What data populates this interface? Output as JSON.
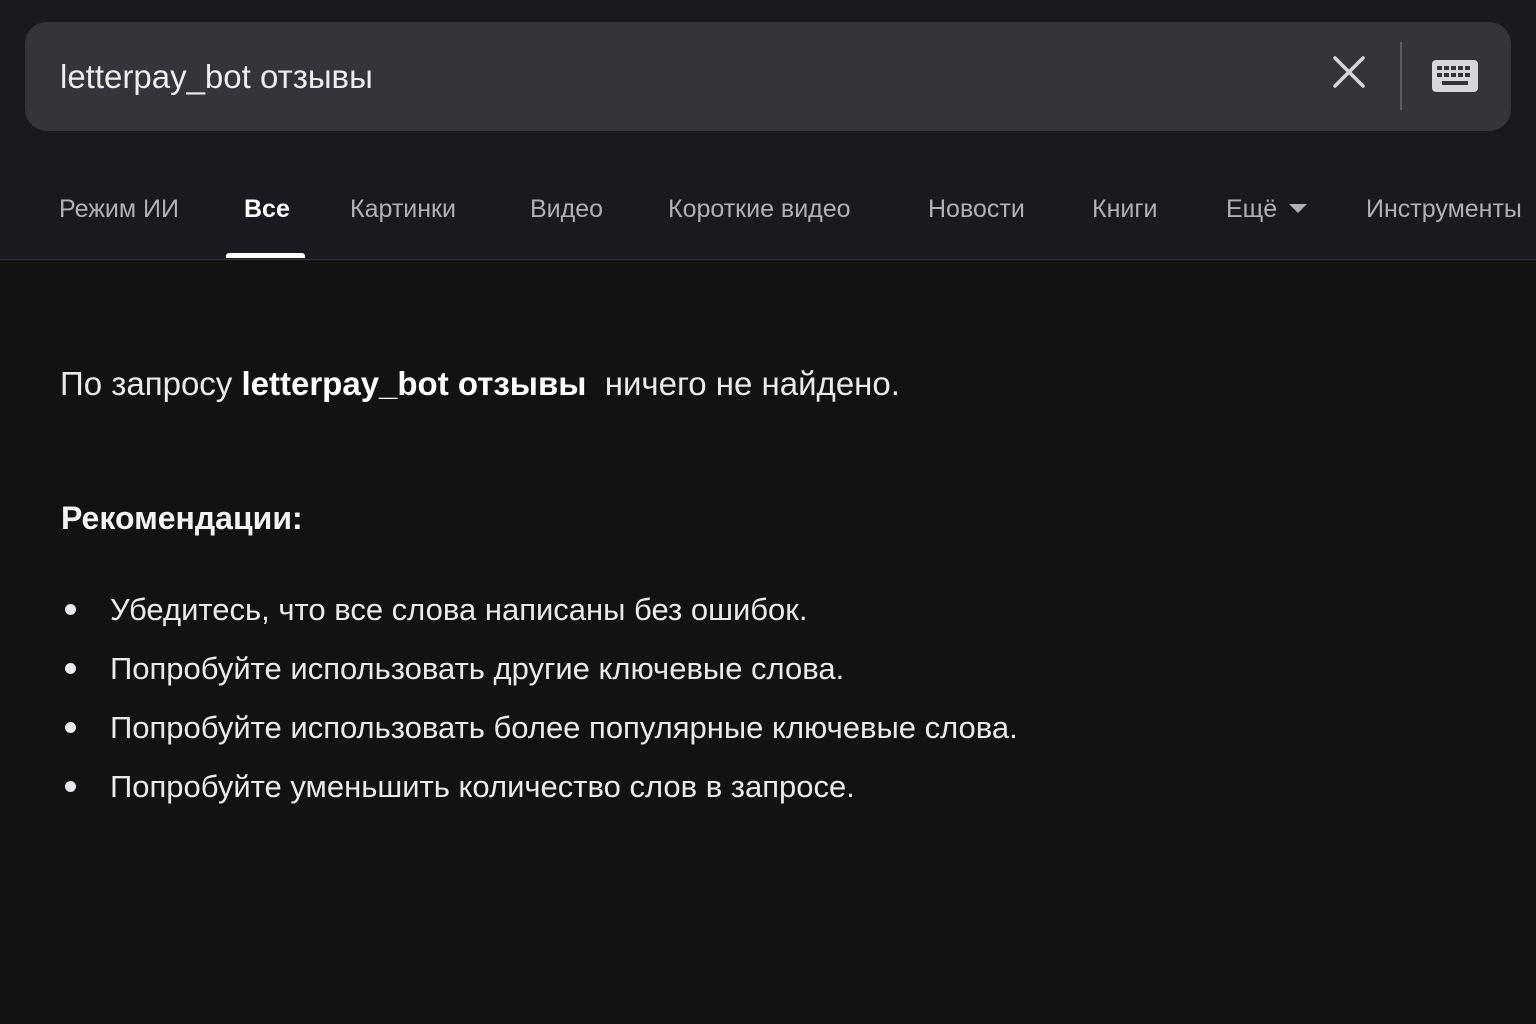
{
  "search": {
    "query": "letterpay_bot отзывы"
  },
  "tabs": [
    {
      "label": "Режим ИИ",
      "active": false
    },
    {
      "label": "Все",
      "active": true
    },
    {
      "label": "Картинки",
      "active": false
    },
    {
      "label": "Видео",
      "active": false
    },
    {
      "label": "Короткие видео",
      "active": false
    },
    {
      "label": "Новости",
      "active": false
    },
    {
      "label": "Книги",
      "active": false
    },
    {
      "label": "Ещё",
      "active": false
    },
    {
      "label": "Инструменты",
      "active": false
    }
  ],
  "noresult": {
    "prefix": "По запросу",
    "query": "letterpay_bot отзывы",
    "suffix": "ничего не найдено."
  },
  "recommendations": {
    "title": "Рекомендации:",
    "items": [
      "Убедитесь, что все слова написаны без ошибок.",
      "Попробуйте использовать другие ключевые слова.",
      "Попробуйте использовать более популярные ключевые слова.",
      "Попробуйте уменьшить количество слов в запросе."
    ]
  },
  "colors": {
    "background": "#121213",
    "header": "#191a20",
    "search_box": "#33353b",
    "active_tab": "#ffffff",
    "inactive_tab": "#aeb1b6"
  },
  "icons": {
    "clear": "close-icon",
    "keyboard": "keyboard-icon",
    "more": "caret-down-icon"
  }
}
